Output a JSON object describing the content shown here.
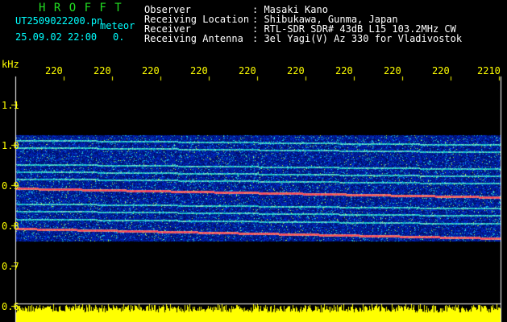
{
  "header": {
    "logo_text": "H R O F F T",
    "filename": "UT2509022200.pn",
    "meteor_label": "meteor",
    "datetime": "25.09.02 22:00",
    "count": "0.",
    "fields": [
      {
        "label": "Observer",
        "value": ": Masaki Kano"
      },
      {
        "label": "Receiving Location",
        "value": ": Shibukawa, Gunma, Japan"
      },
      {
        "label": "Receiver",
        "value": ": RTL-SDR SDR# 43dB L15 103.2MHz CW"
      },
      {
        "label": "Receiving Antenna",
        "value": ": 3el Yagi(V) Az 330 for Vladivostok"
      }
    ]
  },
  "spectrogram": {
    "y_unit": "kHz",
    "y_ticks": [
      "1.1",
      "1.0",
      "0.9",
      "0.8",
      "0.7",
      "0.6"
    ],
    "x_ticks": [
      "220",
      "220",
      "220",
      "220",
      "220",
      "220",
      "220",
      "220",
      "220",
      "2210"
    ],
    "colors": {
      "background": "#000000",
      "signal_band": "#1030c0",
      "carrier": "#ff2040",
      "noise": "#ffff00",
      "axis": "#ffffff"
    }
  }
}
